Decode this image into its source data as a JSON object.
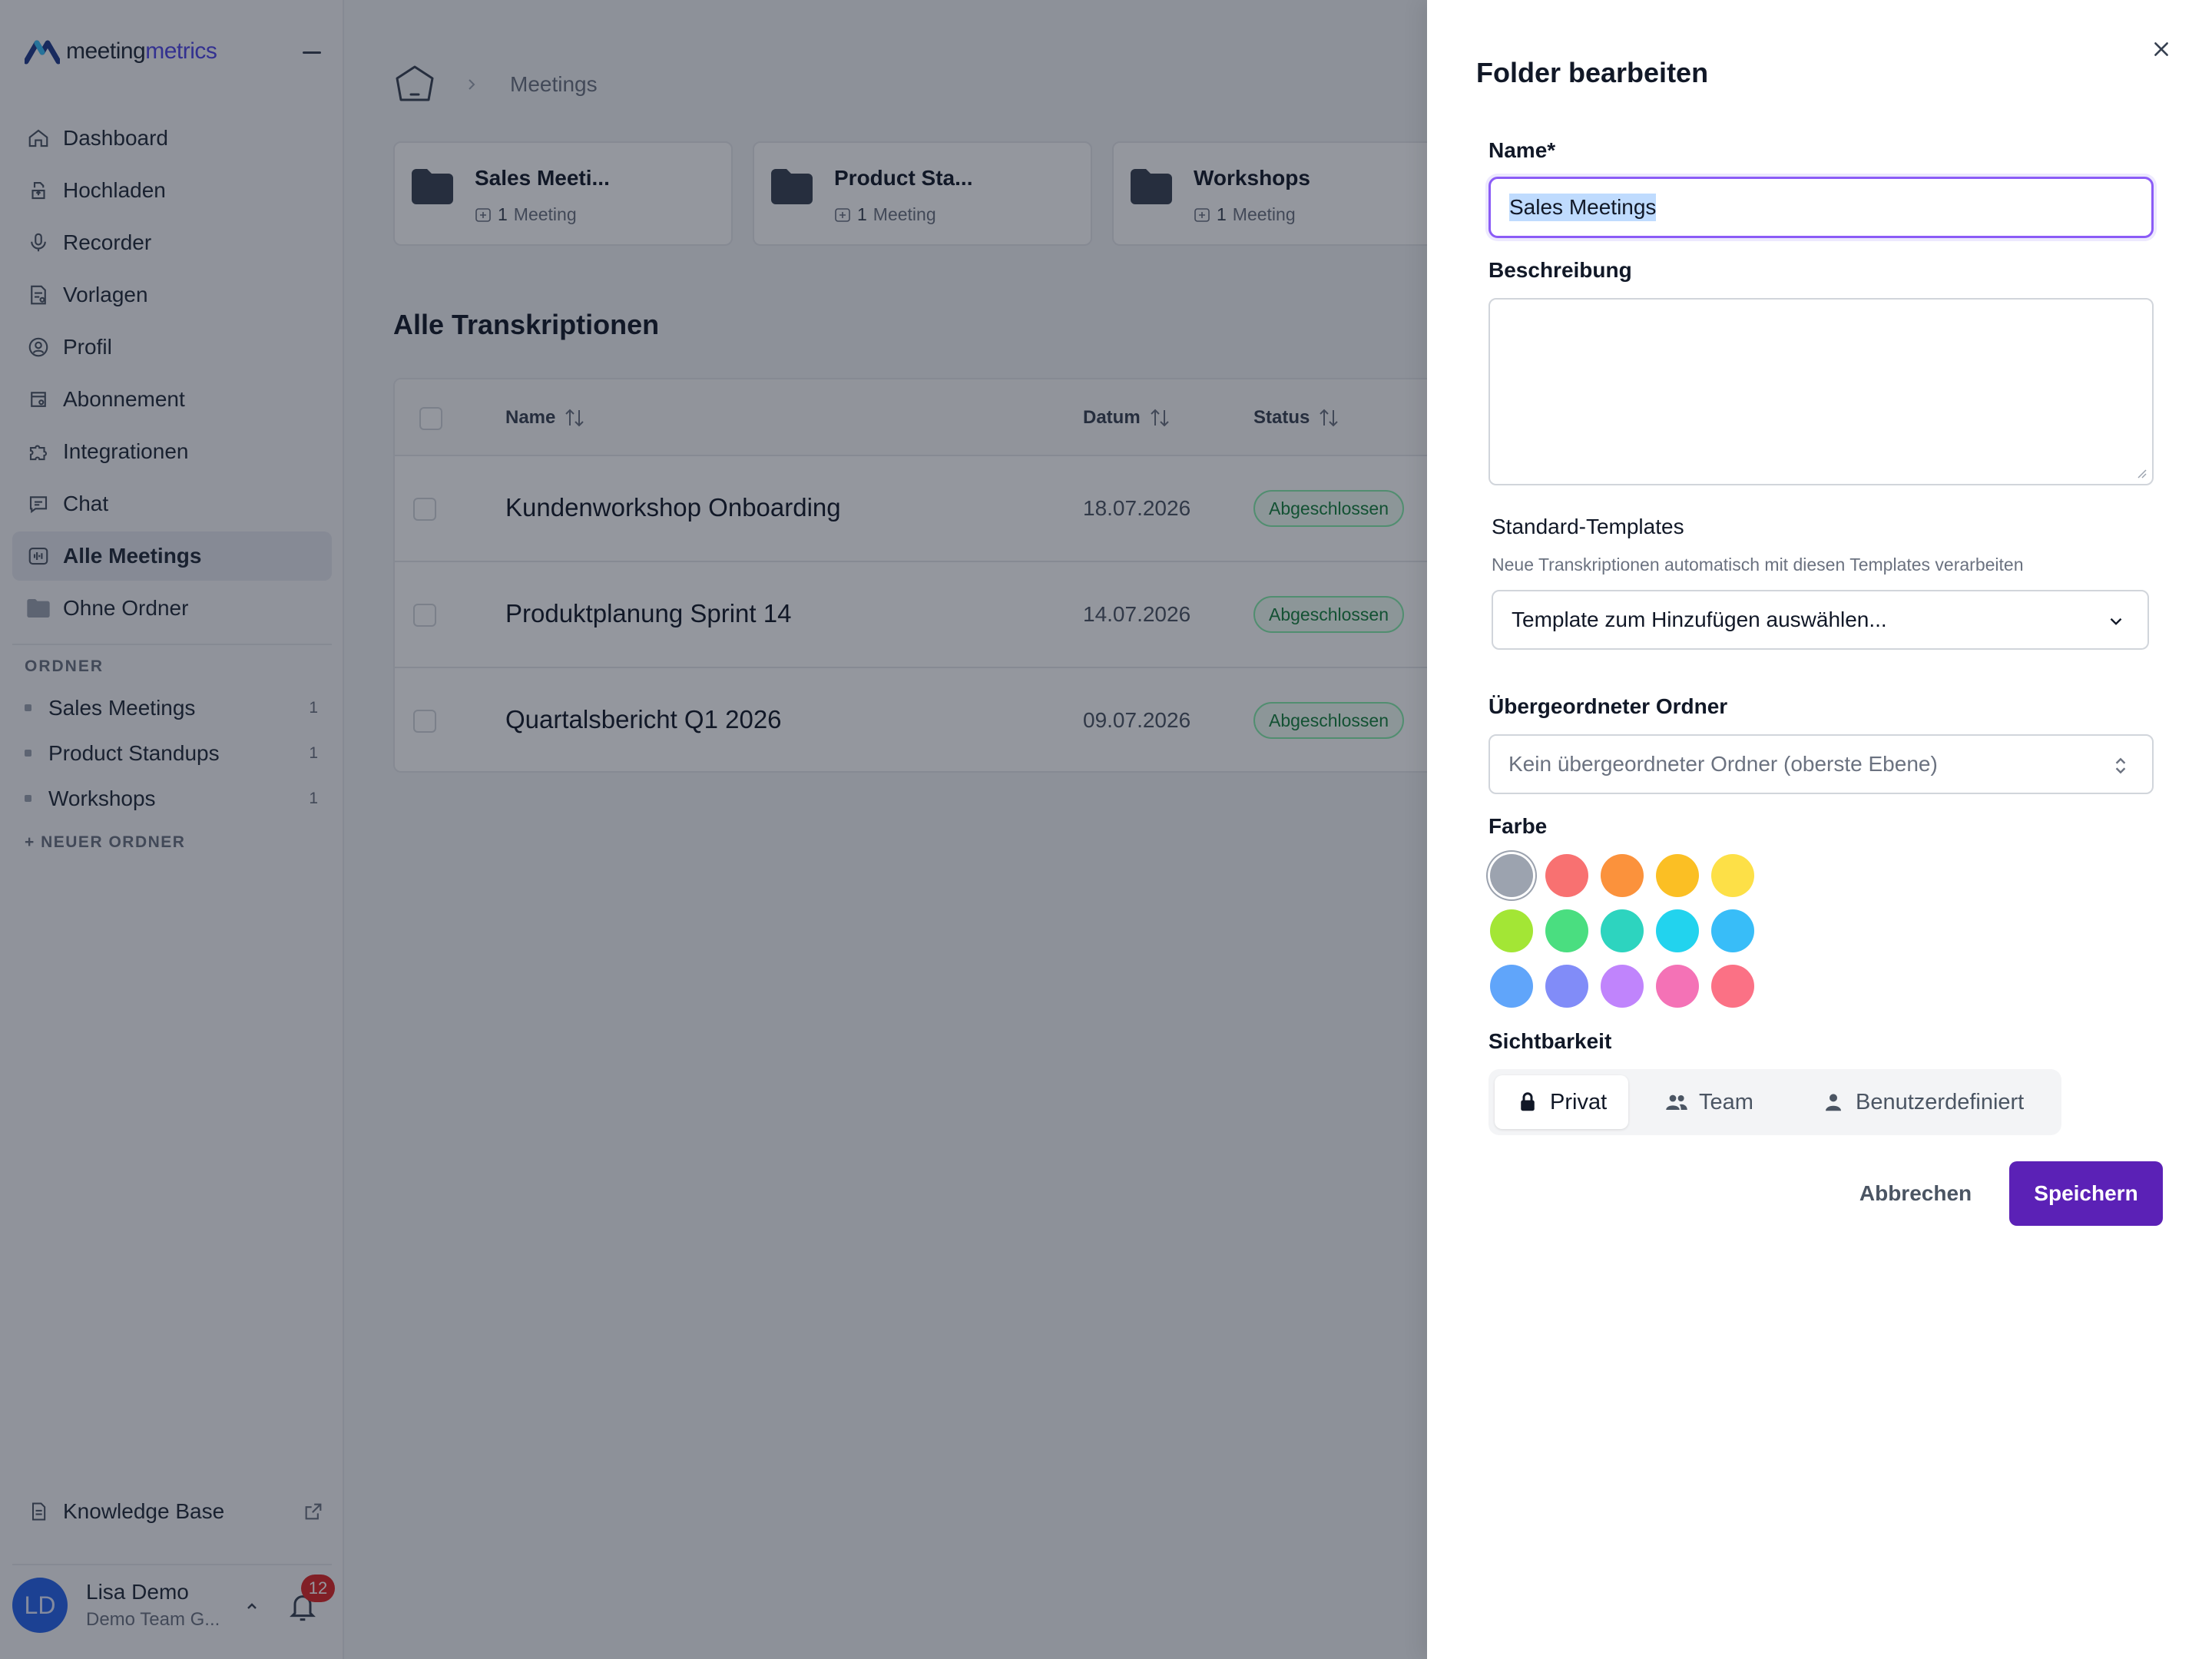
{
  "brand": {
    "name_part1": "meeting",
    "name_part2": "metrics",
    "logo_color": "#1e3a8a",
    "accent": "#4f46e5"
  },
  "sidebar": {
    "nav": [
      {
        "label": "Dashboard",
        "icon": "home-icon"
      },
      {
        "label": "Hochladen",
        "icon": "upload-icon"
      },
      {
        "label": "Recorder",
        "icon": "microphone-icon"
      },
      {
        "label": "Vorlagen",
        "icon": "template-icon"
      },
      {
        "label": "Profil",
        "icon": "user-gear-icon"
      },
      {
        "label": "Abonnement",
        "icon": "subscription-icon"
      },
      {
        "label": "Integrationen",
        "icon": "puzzle-icon"
      },
      {
        "label": "Chat",
        "icon": "chat-icon"
      },
      {
        "label": "Alle Meetings",
        "icon": "waveform-icon",
        "active": true
      },
      {
        "label": "Ohne Ordner",
        "icon": "folder-icon"
      }
    ],
    "folders_label": "ORDNER",
    "folders": [
      {
        "label": "Sales Meetings",
        "count": "1"
      },
      {
        "label": "Product Standups",
        "count": "1"
      },
      {
        "label": "Workshops",
        "count": "1"
      }
    ],
    "new_folder_label": "+ NEUER ORDNER",
    "knowledge_base": "Knowledge Base",
    "user": {
      "initials": "LD",
      "name": "Lisa Demo",
      "team": "Demo Team G...",
      "notifications": "12"
    }
  },
  "main": {
    "breadcrumb": "Meetings",
    "folder_cards": [
      {
        "title": "Sales Meeti...",
        "count": "1",
        "unit": "Meeting"
      },
      {
        "title": "Product Sta...",
        "count": "1",
        "unit": "Meeting"
      },
      {
        "title": "Workshops",
        "count": "1",
        "unit": "Meeting"
      }
    ],
    "section_title": "Alle Transkriptionen",
    "table": {
      "headers": {
        "name": "Name",
        "date": "Datum",
        "status": "Status"
      },
      "rows": [
        {
          "name": "Kundenworkshop Onboarding",
          "date": "18.07.2026",
          "status": "Abgeschlossen"
        },
        {
          "name": "Produktplanung Sprint 14",
          "date": "14.07.2026",
          "status": "Abgeschlossen"
        },
        {
          "name": "Quartalsbericht Q1 2026",
          "date": "09.07.2026",
          "status": "Abgeschlossen"
        }
      ]
    }
  },
  "drawer": {
    "title": "Folder bearbeiten",
    "name_label": "Name*",
    "name_value": "Sales Meetings",
    "description_label": "Beschreibung",
    "description_value": "",
    "templates_label": "Standard-Templates",
    "templates_help": "Neue Transkriptionen automatisch mit diesen Templates verarbeiten",
    "templates_placeholder": "Template zum Hinzufügen auswählen...",
    "parent_label": "Übergeordneter Ordner",
    "parent_value": "Kein übergeordneter Ordner (oberste Ebene)",
    "color_label": "Farbe",
    "colors": [
      "#9ca3af",
      "#f87171",
      "#fb923c",
      "#fbbf24",
      "#fde047",
      "#a3e635",
      "#4ade80",
      "#2dd4bf",
      "#22d3ee",
      "#38bdf8",
      "#60a5fa",
      "#818cf8",
      "#c084fc",
      "#f472b6",
      "#fb7185"
    ],
    "selected_color": "#9ca3af",
    "visibility_label": "Sichtbarkeit",
    "visibility_options": [
      {
        "label": "Privat",
        "icon": "lock-icon",
        "active": true
      },
      {
        "label": "Team",
        "icon": "users-icon"
      },
      {
        "label": "Benutzerdefiniert",
        "icon": "user-icon"
      }
    ],
    "cancel_label": "Abbrechen",
    "save_label": "Speichern",
    "save_color": "#5b21b6"
  }
}
